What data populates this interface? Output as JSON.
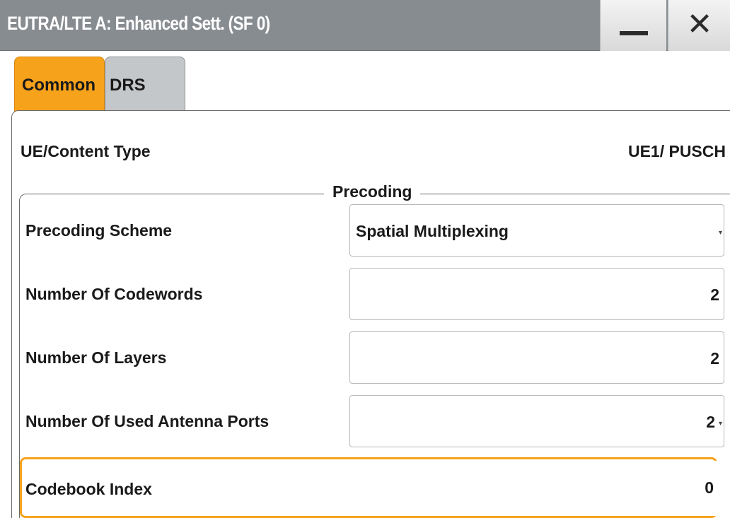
{
  "window": {
    "title": "EUTRA/LTE A: Enhanced Sett. (SF 0)",
    "minimize_glyph": "minimize-icon",
    "close_glyph": "✕"
  },
  "tabs": [
    {
      "label": "Common",
      "active": true
    },
    {
      "label": "DRS",
      "active": false
    }
  ],
  "content": {
    "ue_label": "UE/Content Type",
    "ue_value": "UE1/ PUSCH"
  },
  "precoding": {
    "title": "Precoding",
    "rows": [
      {
        "label": "Precoding Scheme",
        "value": "Spatial Multiplexing",
        "dropdown": true
      },
      {
        "label": "Number Of Codewords",
        "value": "2"
      },
      {
        "label": "Number Of Layers",
        "value": "2"
      },
      {
        "label": "Number Of Used Antenna Ports",
        "value": "2",
        "dropdown": true
      },
      {
        "label": "Codebook Index",
        "value": "0",
        "focused": true
      }
    ]
  },
  "colors": {
    "titlebar": "#878c91",
    "active_tab": "#f7a21b",
    "inactive_tab": "#c4c7ca",
    "focus_border": "#f5a31c"
  }
}
